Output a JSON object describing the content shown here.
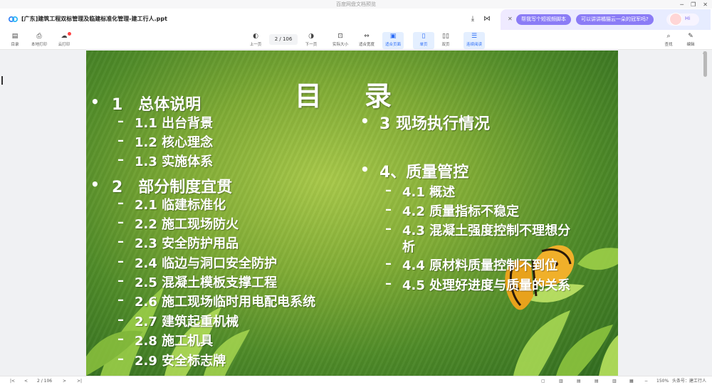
{
  "window": {
    "title": "百度网盘文档预览"
  },
  "file": {
    "name": "[广东]建筑工程双标管理及临建标准化管理-建工行人.ppt"
  },
  "ai": {
    "chip1": "帮我写个短视频脚本",
    "chip2": "可以讲讲橘猫云一朵的冠军吗?",
    "hi": "Hi"
  },
  "toolbar": {
    "toc": "目录",
    "local_print": "本地打印",
    "cloud_print": "云打印",
    "prev": "上一页",
    "page_indicator": "2 / 106",
    "next": "下一页",
    "actual_size": "实际大小",
    "fit_width": "适合宽度",
    "fit_page": "适合页面",
    "single": "单页",
    "double": "双页",
    "continuous": "连续阅读",
    "search": "查找",
    "edit": "编辑"
  },
  "slide": {
    "title": "目录",
    "left": [
      {
        "level": 1,
        "text": "1　总体说明"
      },
      {
        "level": 2,
        "text": "1.1 出台背景"
      },
      {
        "level": 2,
        "text": "1.2 核心理念"
      },
      {
        "level": 2,
        "text": "1.3 实施体系"
      },
      {
        "level": 1,
        "text": "2　部分制度宜贯"
      },
      {
        "level": 2,
        "text": "2.1  临建标准化"
      },
      {
        "level": 2,
        "text": "2.2  施工现场防火"
      },
      {
        "level": 2,
        "text": "2.3  安全防护用品"
      },
      {
        "level": 2,
        "text": "2.4  临边与洞口安全防护"
      },
      {
        "level": 2,
        "text": "2.5  混凝土模板支撑工程"
      },
      {
        "level": 2,
        "text": "2.6  施工现场临时用电配电系统"
      },
      {
        "level": 2,
        "text": "2.7  建筑起重机械"
      },
      {
        "level": 2,
        "text": "2.8  施工机具"
      },
      {
        "level": 2,
        "text": "2.9  安全标志牌"
      }
    ],
    "right": [
      {
        "level": 1,
        "text": "3 现场执行情况"
      },
      {
        "level": 1,
        "text": "4、质量管控"
      },
      {
        "level": 2,
        "text": "4.1  概述"
      },
      {
        "level": 2,
        "text": "4.2  质量指标不稳定"
      },
      {
        "level": 2,
        "text": "4.3  混凝土强度控制不理想分"
      },
      {
        "level": 2,
        "text": "析"
      },
      {
        "level": 2,
        "text": "4.4  原材料质量控制不到位"
      },
      {
        "level": 2,
        "text": "4.5  处理好进度与质量的关系"
      }
    ]
  },
  "bottombar": {
    "page_indicator": "2 / 106",
    "zoom": "150%",
    "watermark": "头条号：建工行人"
  },
  "colors": {
    "accent": "#2b6cf6",
    "ai_chip": "#8b7cf6"
  }
}
